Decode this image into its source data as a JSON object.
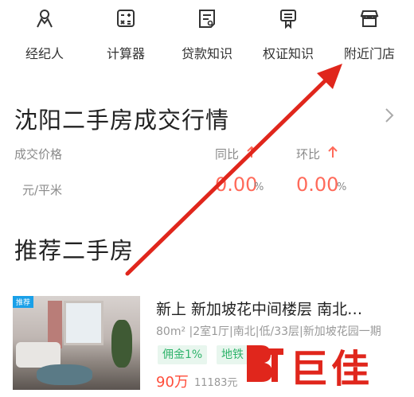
{
  "nav": [
    {
      "label": "经纪人",
      "icon": "agent-icon"
    },
    {
      "label": "计算器",
      "icon": "calculator-icon"
    },
    {
      "label": "贷款知识",
      "icon": "loan-document-icon"
    },
    {
      "label": "权证知识",
      "icon": "certificate-icon"
    },
    {
      "label": "附近门店",
      "icon": "store-icon"
    }
  ],
  "market": {
    "title": "沈阳二手房成交行情",
    "price_label": "成交价格",
    "price_unit": "元/平米",
    "yoy_label": "同比",
    "yoy_value": "0.00",
    "yoy_unit": "%",
    "mom_label": "环比",
    "mom_value": "0.00",
    "mom_unit": "%"
  },
  "recommend": {
    "title": "推荐二手房",
    "listing": {
      "badge": "推荐",
      "title": "新上 新加坡花中间楼层 南北…",
      "info": "80m² |2室1厅|南北|低/33层|新加坡花园一期",
      "tags": [
        "佣金1%",
        "地铁"
      ],
      "price": "90万",
      "unit_price": "11183元"
    }
  },
  "watermark": "巨佳",
  "colors": {
    "accent_red": "#ff6a5a",
    "tag_green": "#2fb36b",
    "arrow": "#e0261c"
  }
}
